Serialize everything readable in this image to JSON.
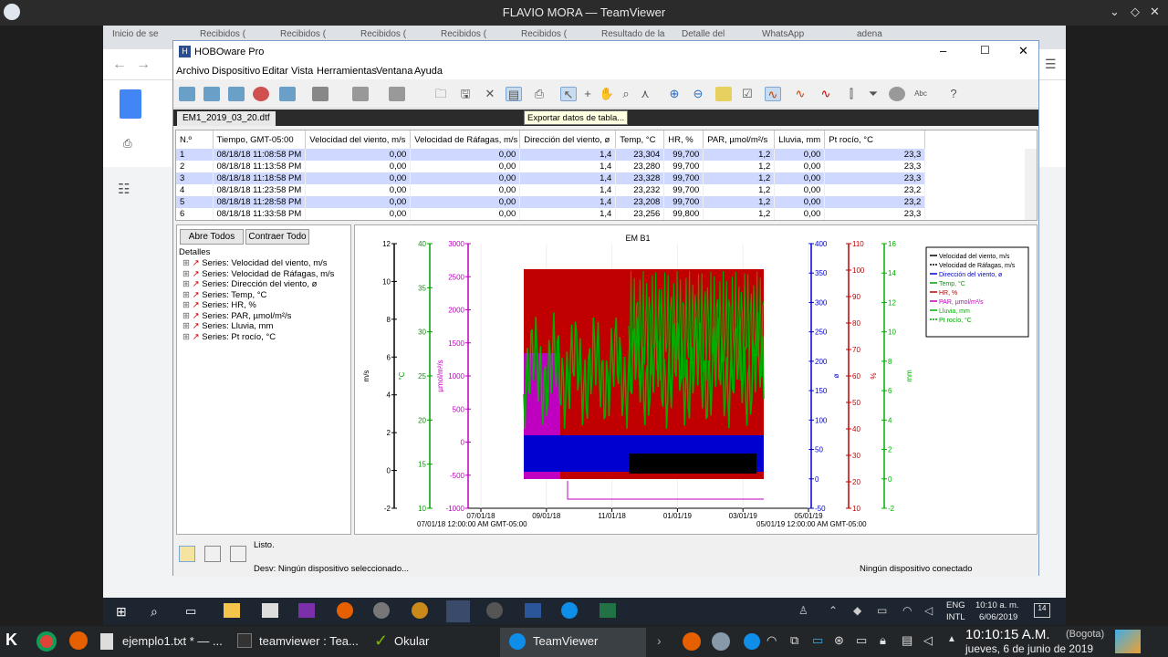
{
  "teamviewer": {
    "title": "FLAVIO MORA — TeamViewer"
  },
  "chrome_tabs": [
    "Inicio de se",
    "Recibidos (",
    "Recibidos (",
    "Recibidos (",
    "Recibidos (",
    "Recibidos (",
    "Resultado de la",
    "Detalle del",
    "WhatsApp",
    "adena"
  ],
  "hobo": {
    "title": "HOBOware Pro",
    "menu": [
      "Archivo",
      "Dispositivo",
      "Editar",
      "Vista",
      "Herramientas",
      "Ventana",
      "Ayuda"
    ],
    "file_tab": "EM1_2019_03_20.dtf",
    "tooltip": "Exportar datos de tabla...",
    "table": {
      "headers": [
        "N.º",
        "Tiempo, GMT-05:00",
        "Velocidad del viento, m/s",
        "Velocidad de Ráfagas, m/s",
        "Dirección del viento, ø",
        "Temp, °C",
        "HR, %",
        "PAR, µmol/m²/s",
        "Lluvia, mm",
        "Pt rocío, °C"
      ],
      "rows": [
        [
          "1",
          "08/18/18 11:08:58 PM",
          "0,00",
          "0,00",
          "1,4",
          "23,304",
          "99,700",
          "1,2",
          "0,00",
          "23,3"
        ],
        [
          "2",
          "08/18/18 11:13:58 PM",
          "0,00",
          "0,00",
          "1,4",
          "23,280",
          "99,700",
          "1,2",
          "0,00",
          "23,3"
        ],
        [
          "3",
          "08/18/18 11:18:58 PM",
          "0,00",
          "0,00",
          "1,4",
          "23,328",
          "99,700",
          "1,2",
          "0,00",
          "23,3"
        ],
        [
          "4",
          "08/18/18 11:23:58 PM",
          "0,00",
          "0,00",
          "1,4",
          "23,232",
          "99,700",
          "1,2",
          "0,00",
          "23,2"
        ],
        [
          "5",
          "08/18/18 11:28:58 PM",
          "0,00",
          "0,00",
          "1,4",
          "23,208",
          "99,700",
          "1,2",
          "0,00",
          "23,2"
        ],
        [
          "6",
          "08/18/18 11:33:58 PM",
          "0,00",
          "0,00",
          "1,4",
          "23,256",
          "99,800",
          "1,2",
          "0,00",
          "23,3"
        ]
      ]
    },
    "details": {
      "open_all": "Abre Todos",
      "collapse_all": "Contraer Todo",
      "label": "Detalles",
      "series": [
        "Series: Velocidad del viento, m/s",
        "Series: Velocidad de Ráfagas, m/s",
        "Series: Dirección del viento, ø",
        "Series: Temp, °C",
        "Series: HR, %",
        "Series: PAR, µmol/m²/s",
        "Series: Lluvia, mm",
        "Series: Pt rocío, °C"
      ]
    },
    "status": {
      "listo": "Listo.",
      "desv": "Desv: Ningún dispositivo seleccionado...",
      "connected": "Ningún dispositivo conectado"
    }
  },
  "chart_data": {
    "type": "line",
    "title": "EM B1",
    "x_ticks": [
      "07/01/18",
      "09/01/18",
      "11/01/18",
      "01/01/19",
      "03/01/19",
      "05/01/19"
    ],
    "x_start_label": "07/01/18 12:00:00 AM GMT-05:00",
    "x_end_label": "05/01/19 12:00:00 AM GMT-05:00",
    "axes": [
      {
        "label": "m/s",
        "ticks": [
          "12",
          "10",
          "8",
          "6",
          "4",
          "2",
          "0",
          "-2"
        ],
        "color": "#000000"
      },
      {
        "label": "°C",
        "ticks": [
          "40",
          "35",
          "30",
          "25",
          "20",
          "15",
          "10"
        ],
        "color": "#00a000"
      },
      {
        "label": "µmol/m²/s",
        "ticks": [
          "3000",
          "2500",
          "2000",
          "1500",
          "1000",
          "500",
          "0",
          "-500",
          "-1000"
        ],
        "color": "#c000c0"
      },
      {
        "label": "ø",
        "ticks": [
          "400",
          "350",
          "300",
          "250",
          "200",
          "150",
          "100",
          "50",
          "0",
          "-50"
        ],
        "color": "#0000d0"
      },
      {
        "label": "%",
        "ticks": [
          "110",
          "100",
          "90",
          "80",
          "70",
          "60",
          "50",
          "40",
          "30",
          "20",
          "10"
        ],
        "color": "#c00000"
      },
      {
        "label": "mm",
        "ticks": [
          "16",
          "14",
          "12",
          "10",
          "8",
          "6",
          "4",
          "2",
          "0",
          "-2"
        ],
        "color": "#00b000"
      }
    ],
    "legend": [
      {
        "name": "Velocidad del viento, m/s",
        "color": "#000000"
      },
      {
        "name": "Velocidad de Ráfagas, m/s",
        "color": "#000000"
      },
      {
        "name": "Dirección del viento, ø",
        "color": "#0000d0"
      },
      {
        "name": "Temp, °C",
        "color": "#00a000"
      },
      {
        "name": "HR, %",
        "color": "#c00000"
      },
      {
        "name": "PAR, µmol/m²/s",
        "color": "#c000c0"
      },
      {
        "name": "Lluvia, mm",
        "color": "#00b000"
      },
      {
        "name": "Pt rocío, °C",
        "color": "#00a000"
      }
    ]
  },
  "windows_tray": {
    "lang": "ENG",
    "layout": "INTL",
    "time": "10:10 a. m.",
    "date": "6/06/2019",
    "badge": "14"
  },
  "kde": {
    "tasks": [
      "ejemplo1.txt * — ...",
      "teamviewer : Tea...",
      "Okular",
      "TeamViewer"
    ],
    "clock_time": "10:10:15 A.M.",
    "clock_city": "(Bogota)",
    "clock_date": "jueves, 6 de junio de 2019"
  }
}
